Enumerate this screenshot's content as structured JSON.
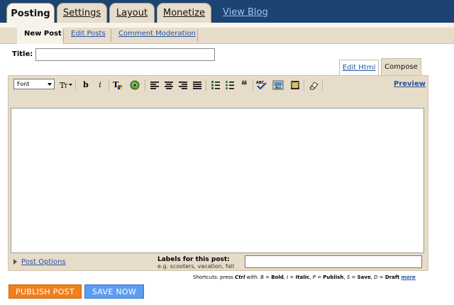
{
  "main_tabs": [
    "Posting",
    "Settings",
    "Layout",
    "Monetize"
  ],
  "view_blog": "View Blog",
  "sub_tabs": [
    "New Post",
    "Edit Posts",
    "Comment Moderation"
  ],
  "title_label": "Title:",
  "title_value": "",
  "mode_tabs": {
    "edit_html": "Edit Html",
    "compose": "Compose"
  },
  "toolbar": {
    "font_select": "Font",
    "bold": "b",
    "italic": "i",
    "preview": "Preview",
    "icons": [
      "font-size-icon",
      "bold-icon",
      "italic-icon",
      "text-color-icon",
      "link-icon",
      "align-left-icon",
      "align-center-icon",
      "align-right-icon",
      "justify-icon",
      "numbered-list-icon",
      "bullet-list-icon",
      "blockquote-icon",
      "spell-check-icon",
      "insert-image-icon",
      "insert-video-icon",
      "remove-formatting-icon"
    ]
  },
  "post_options": "Post Options",
  "labels": {
    "title": "Labels for this post:",
    "hint": "e.g. scooters, vacation, fall",
    "value": ""
  },
  "shortcuts": {
    "prefix": "Shortcuts: press",
    "ctrl": "Ctrl",
    "with": "with:",
    "b_key": "B",
    "b_label": "Bold",
    "i_key": "I",
    "i_label": "Italic",
    "p_key": "P",
    "p_label": "Publish",
    "s_key": "S",
    "s_label": "Save",
    "d_key": "D",
    "d_label": "Draft",
    "more": "more"
  },
  "buttons": {
    "publish": "PUBLISH POST",
    "save": "SAVE NOW"
  },
  "colors": {
    "topbar": "#1b4472",
    "panel": "#e6dcc9",
    "publish": "#f07f1c",
    "save": "#5d9cf0",
    "link": "#2752a4"
  }
}
